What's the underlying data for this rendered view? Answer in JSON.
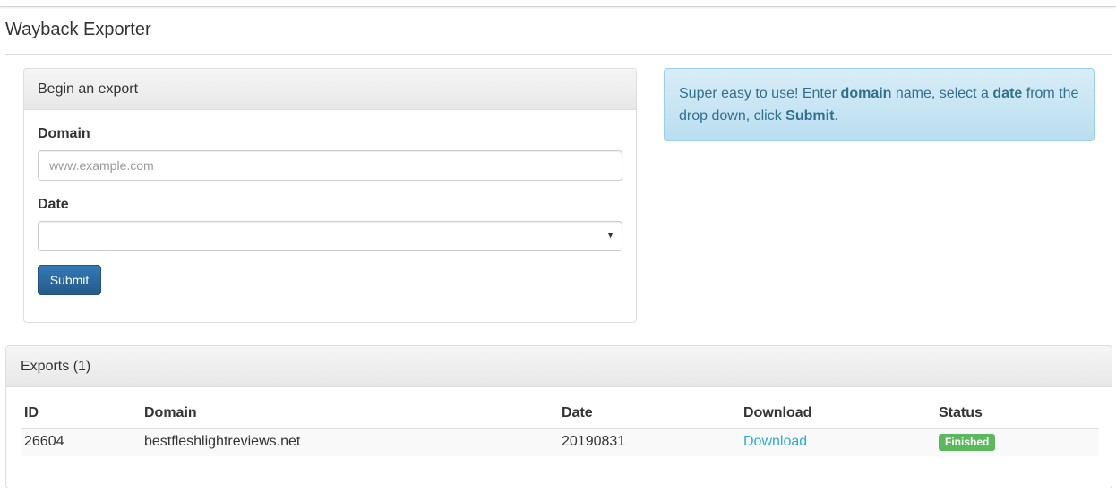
{
  "app": {
    "title": "Wayback Exporter"
  },
  "export_form": {
    "header": "Begin an export",
    "domain_label": "Domain",
    "domain_placeholder": "www.example.com",
    "domain_value": "",
    "date_label": "Date",
    "date_value": "",
    "submit_label": "Submit"
  },
  "info": {
    "prefix": "Super easy to use! Enter ",
    "domain_word": "domain",
    "middle": " name, select a ",
    "date_word": "date",
    "after_date": " from the drop down, click ",
    "submit_word": "Submit",
    "suffix": "."
  },
  "exports": {
    "header": "Exports (1)",
    "columns": [
      "ID",
      "Domain",
      "Date",
      "Download",
      "Status"
    ],
    "rows": [
      {
        "id": "26604",
        "domain": "bestfleshlightreviews.net",
        "date": "20190831",
        "download": "Download",
        "status": "Finished"
      }
    ]
  },
  "colors": {
    "primary": "#337ab7",
    "info_bg": "#d9edf7",
    "info_text": "#31708f",
    "success": "#5cb85c",
    "link": "#2aabd2"
  }
}
